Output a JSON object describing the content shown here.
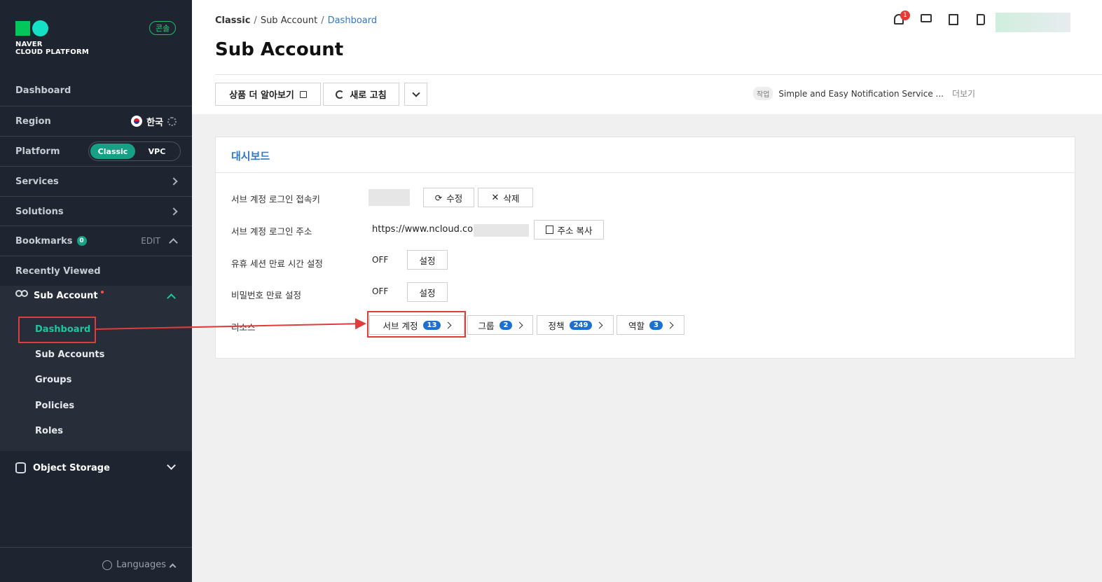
{
  "sidebar": {
    "logo_text_1": "NAVER",
    "logo_text_2": "CLOUD PLATFORM",
    "console_badge": "콘솔",
    "dashboard": "Dashboard",
    "region_label": "Region",
    "region_value": "한국",
    "platform_label": "Platform",
    "platform_options": [
      "Classic",
      "VPC"
    ],
    "platform_selected": "Classic",
    "services": "Services",
    "solutions": "Solutions",
    "bookmarks": "Bookmarks",
    "bookmarks_count": "0",
    "bookmarks_edit": "EDIT",
    "recently_viewed": "Recently Viewed",
    "sub_account": "Sub Account",
    "sub_items": [
      "Dashboard",
      "Sub Accounts",
      "Groups",
      "Policies",
      "Roles"
    ],
    "sub_active": "Dashboard",
    "object_storage": "Object Storage",
    "languages": "Languages"
  },
  "header": {
    "breadcrumb": [
      "Classic",
      "Sub Account",
      "Dashboard"
    ],
    "title": "Sub Account",
    "notification_count": "1",
    "toolbar": {
      "learn_more": "상품 더 알아보기",
      "refresh": "새로 고침"
    },
    "job_tag": "작업",
    "job_text": "Simple and Easy Notification Service ...",
    "job_more": "더보기"
  },
  "card": {
    "title": "대시보드",
    "rows": {
      "login_key_label": "서브 계정 로그인 접속키",
      "edit_btn": "수정",
      "delete_btn": "삭제",
      "login_url_label": "서브 계정 로그인 주소",
      "login_url": "https://www.ncloud.com",
      "copy_btn": "주소 복사",
      "idle_label": "유휴 세션 만료 시간 설정",
      "idle_value": "OFF",
      "idle_btn": "설정",
      "pw_label": "비밀번호 만료 설정",
      "pw_value": "OFF",
      "pw_btn": "설정",
      "resource_label": "리소스"
    },
    "resources": [
      {
        "label": "서브 계정",
        "count": "13"
      },
      {
        "label": "그룹",
        "count": "2"
      },
      {
        "label": "정책",
        "count": "249"
      },
      {
        "label": "역할",
        "count": "3"
      }
    ]
  },
  "colors": {
    "sidebar_bg": "#1f2530",
    "accent": "#16a085",
    "link": "#2f78c4",
    "highlight": "#e03c3c",
    "badge": "#1d6fd1"
  }
}
